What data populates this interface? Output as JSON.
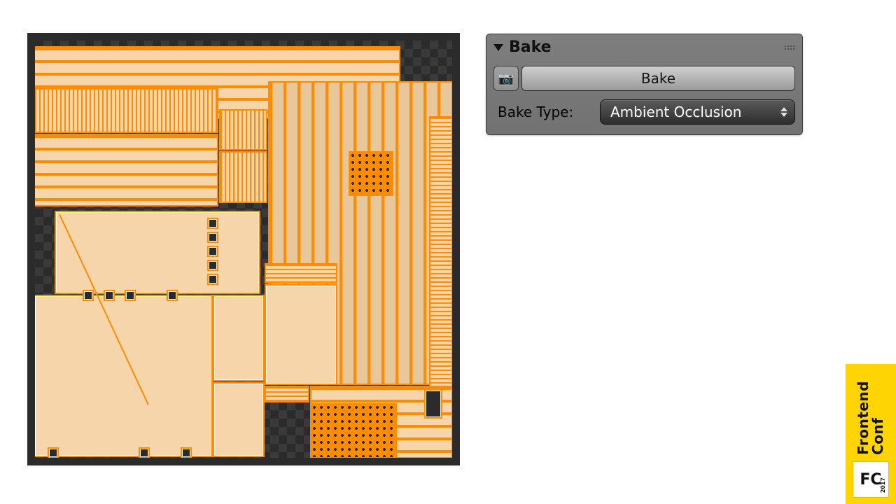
{
  "bake_panel": {
    "title": "Bake",
    "button_label": "Bake",
    "type_label": "Bake Type:",
    "type_value": "Ambient Occlusion"
  },
  "badge": {
    "brand_line1": "Frontend",
    "brand_line2": "Conf",
    "logo_text": "FC",
    "year": "2017"
  },
  "icons": {
    "camera": "📷"
  }
}
